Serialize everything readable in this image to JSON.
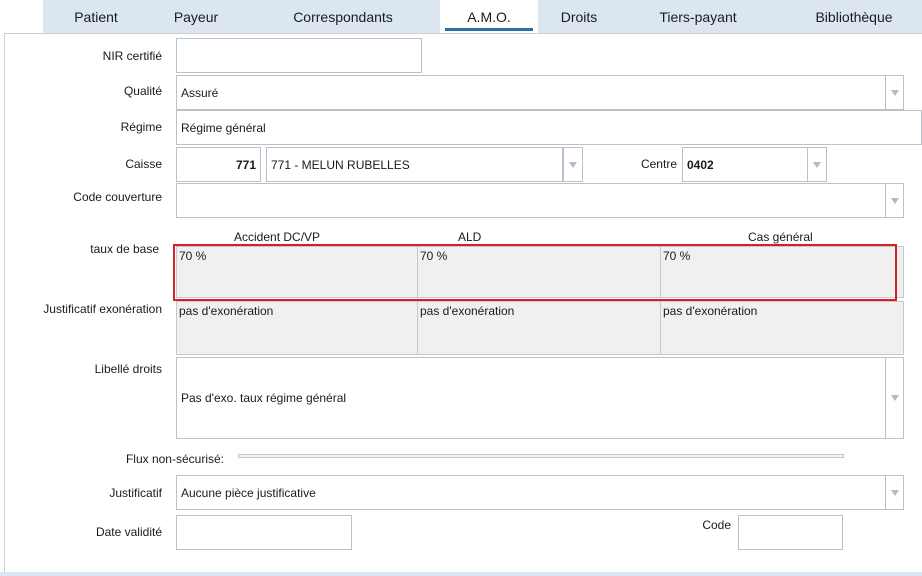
{
  "tabs": [
    {
      "id": "patient",
      "label": "Patient"
    },
    {
      "id": "payeur",
      "label": "Payeur"
    },
    {
      "id": "correspondants",
      "label": "Correspondants"
    },
    {
      "id": "amo",
      "label": "A.M.O."
    },
    {
      "id": "droits",
      "label": "Droits"
    },
    {
      "id": "tiers_payant",
      "label": "Tiers-payant"
    },
    {
      "id": "bibliotheque",
      "label": "Bibliothèque"
    }
  ],
  "active_tab": "A.M.O.",
  "form": {
    "nir": {
      "label": "NIR certifié",
      "value": ""
    },
    "qualite": {
      "label": "Qualité",
      "value": "Assuré"
    },
    "regime": {
      "label": "Régime",
      "value": "Régime général"
    },
    "caisse": {
      "label": "Caisse",
      "code": "771",
      "value": "771 - MELUN RUBELLES"
    },
    "centre": {
      "label": "Centre",
      "value": "0402"
    },
    "code_couverture": {
      "label": "Code couverture",
      "value": ""
    },
    "taux_de_base": {
      "label": "taux de base",
      "columns": [
        "Accident DC/VP",
        "ALD",
        "Cas général"
      ],
      "values": [
        "70 %",
        "70 %",
        "70 %"
      ]
    },
    "justificatif_exoneration": {
      "label": "Justificatif exonération",
      "values": [
        "pas d'exonération",
        "pas d'exonération",
        "pas d'exonération"
      ]
    },
    "libelle_droits": {
      "label": "Libellé droits",
      "value": "Pas d'exo. taux régime général"
    },
    "flux_non_securise": {
      "label": "Flux non-sécurisé:"
    },
    "justificatif": {
      "label": "Justificatif",
      "value": "Aucune pièce justificative"
    },
    "date_validite": {
      "label": "Date validité",
      "value": ""
    },
    "code": {
      "label": "Code",
      "value": ""
    }
  },
  "colors": {
    "tab_bar": "#dbe6f1",
    "active_tab_underline": "#2f6fa8",
    "highlight_box": "#d62027",
    "readonly_cell": "#f0f0f0"
  }
}
